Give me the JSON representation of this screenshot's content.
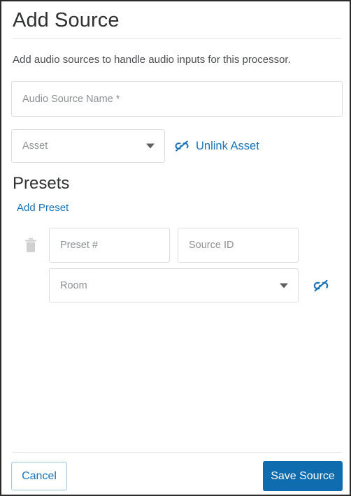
{
  "dialog": {
    "title": "Add Source",
    "description": "Add audio sources to handle audio inputs for this processor."
  },
  "form": {
    "audio_source_name": {
      "placeholder": "Audio Source Name *",
      "value": ""
    },
    "asset_select": {
      "placeholder": "Asset",
      "value": "",
      "caret_icon": "chevron-down-icon"
    },
    "unlink_asset": {
      "label": "Unlink Asset",
      "icon": "link-off-icon",
      "color": "#1a73b8"
    }
  },
  "presets": {
    "heading": "Presets",
    "add_link": "Add Preset",
    "rows": [
      {
        "delete_icon": "trash-icon",
        "preset_number": {
          "placeholder": "Preset #",
          "value": ""
        },
        "source_id": {
          "placeholder": "Source ID",
          "value": ""
        },
        "room_select": {
          "placeholder": "Room",
          "value": "",
          "caret_icon": "chevron-down-icon"
        },
        "unlink_room": {
          "icon": "link-off-icon",
          "color": "#1a73b8"
        }
      }
    ]
  },
  "footer": {
    "cancel_label": "Cancel",
    "save_label": "Save Source"
  },
  "colors": {
    "accent_blue": "#1a73b8",
    "primary_button": "#0f6cae",
    "border_gray": "#dcdcdc",
    "placeholder_gray": "#8d9194",
    "divider": "#e7e7e8",
    "heading": "#2f3133",
    "trash_gray": "#cfd1d2"
  }
}
